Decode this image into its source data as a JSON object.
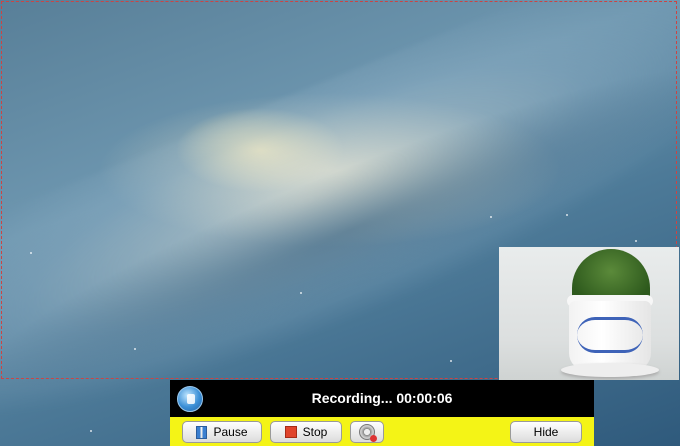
{
  "recorder": {
    "status_text": "Recording... 00:00:06",
    "buttons": {
      "pause_label": "Pause",
      "stop_label": "Stop",
      "hide_label": "Hide"
    },
    "icons": {
      "logo": "recorder-logo-icon",
      "pause": "pause-icon",
      "stop": "stop-icon",
      "webcam": "webcam-toggle-icon"
    },
    "colors": {
      "status_bar": "#000000",
      "controls_bar": "#f4f416",
      "capture_border": "#c44444"
    }
  }
}
